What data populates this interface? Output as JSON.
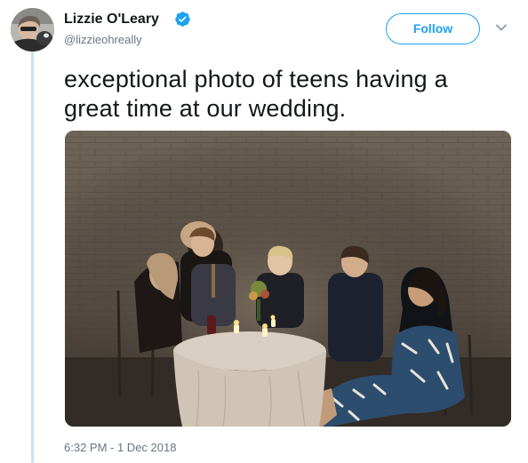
{
  "author": {
    "display_name": "Lizzie O'Leary",
    "handle": "@lizzieohreally",
    "verified": true
  },
  "actions": {
    "follow_label": "Follow",
    "more_icon": "chevron-down-icon"
  },
  "tweet": {
    "text": "exceptional photo of teens having a great time at our wedding.",
    "timestamp": "6:32 PM - 1 Dec 2018"
  },
  "colors": {
    "accent": "#1da1f2",
    "secondary_text": "#657786",
    "thread_line": "#c4e4ef"
  }
}
